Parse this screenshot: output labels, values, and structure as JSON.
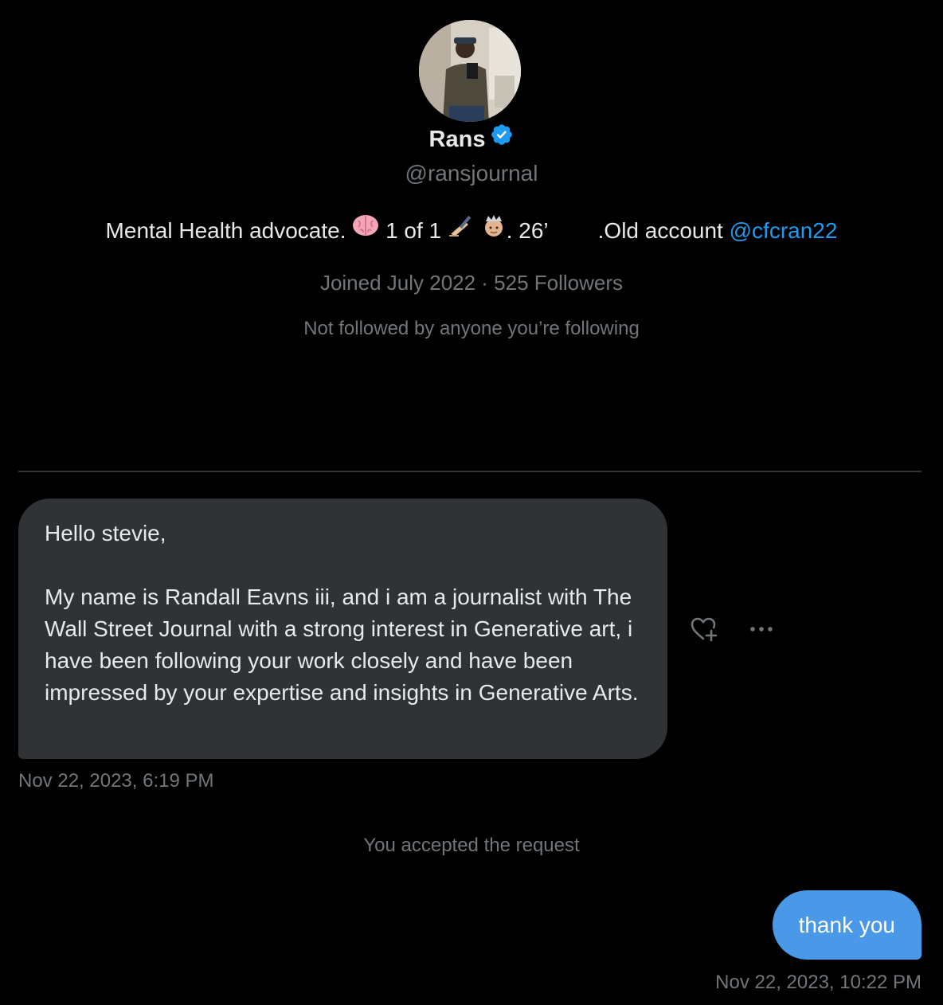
{
  "profile": {
    "name": "Rans",
    "handle": "@ransjournal",
    "bio": {
      "part1": "Mental Health advocate.",
      "emoji_brain": "brain-emoji",
      "part2": "1 of 1",
      "emoji_writing": "writing-hand-emoji",
      "emoji_face": "crowned-face-emoji",
      "part3": ". 26’",
      "part4": ".Old account",
      "link": "@cfcran22"
    },
    "meta": "Joined July 2022 · 525 Followers",
    "mutuals": "Not followed by anyone you’re following"
  },
  "conversation": {
    "incoming": {
      "text": "Hello stevie,\n\nMy name is Randall Eavns iii, and i am a journalist with The Wall Street Journal with a strong interest in Generative art, i have been following your work closely and have been impressed by your expertise and insights in Generative Arts.",
      "timestamp": "Nov 22, 2023, 6:19 PM"
    },
    "system_notice": "You accepted the request",
    "outgoing": {
      "text": "thank you",
      "timestamp": "Nov 22, 2023, 10:22 PM"
    }
  },
  "icons": {
    "verified": "verified-badge-icon",
    "react": "heart-plus-icon",
    "more": "more-icon"
  },
  "colors": {
    "background": "#000000",
    "text_primary": "#e7e9ea",
    "text_secondary": "#71767b",
    "link": "#1d9bf0",
    "incoming_bubble": "#2f3336",
    "outgoing_bubble": "#4a99e9",
    "verified": "#1d9bf0"
  }
}
